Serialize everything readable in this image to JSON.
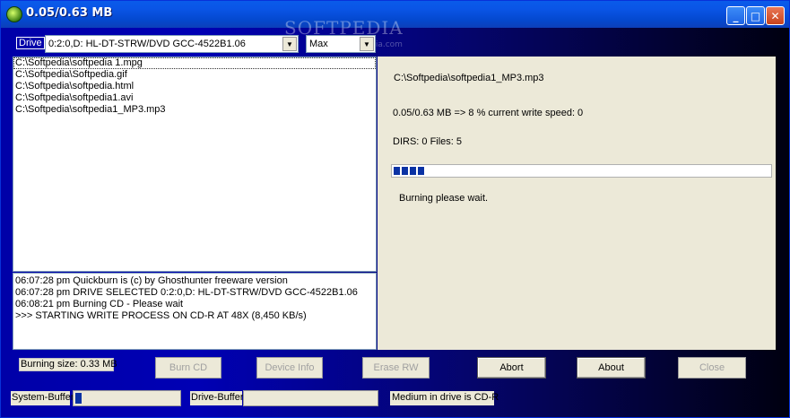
{
  "window": {
    "title": "0.05/0.63 MB",
    "watermark": "SOFTPEDIA",
    "watermark_small": "www.softpedia.com",
    "controls": {
      "minimize": "_",
      "maximize": "□",
      "close": "✕"
    }
  },
  "drive": {
    "label": "Drive",
    "selected": "0:2:0,D: HL-DT-STRW/DVD GCC-4522B1.06",
    "speed_selected": "Max"
  },
  "files": [
    "C:\\Softpedia\\softpedia 1.mpg",
    "C:\\Softpedia\\Softpedia.gif",
    "C:\\Softpedia\\softpedia.html",
    "C:\\Softpedia\\softpedia1.avi",
    "C:\\Softpedia\\softpedia1_MP3.mp3"
  ],
  "log": [
    "06:07:28 pm  Quickburn is (c) by Ghosthunter freeware version",
    "06:07:28 pm  DRIVE SELECTED 0:2:0,D: HL-DT-STRW/DVD GCC-4522B1.06",
    "06:08:21 pm  Burning CD - Please wait",
    ">>> STARTING WRITE PROCESS ON CD-R AT 48X (8,450 KB/s)"
  ],
  "status": {
    "current_file": "C:\\Softpedia\\softpedia1_MP3.mp3",
    "progress_text": "0.05/0.63 MB => 8 % current write speed: 0",
    "dirs_text": "DIRS: 0 Files: 5",
    "progress_percent": 8,
    "message": "Burning please wait."
  },
  "burning_size": "Burning size: 0.33 MB",
  "buttons": {
    "burn_cd": "Burn CD",
    "device_info": "Device Info",
    "erase_rw": "Erase RW",
    "abort": "Abort",
    "about": "About",
    "close": "Close"
  },
  "buffers": {
    "system_label": "System-Buffer",
    "system_percent": 6,
    "drive_label": "Drive-Buffer",
    "drive_percent": 0
  },
  "medium": "Medium in drive is CD-R",
  "colors": {
    "accent": "#0a32a4",
    "title_bar": "#0a55e6",
    "background": "#0000a8"
  }
}
